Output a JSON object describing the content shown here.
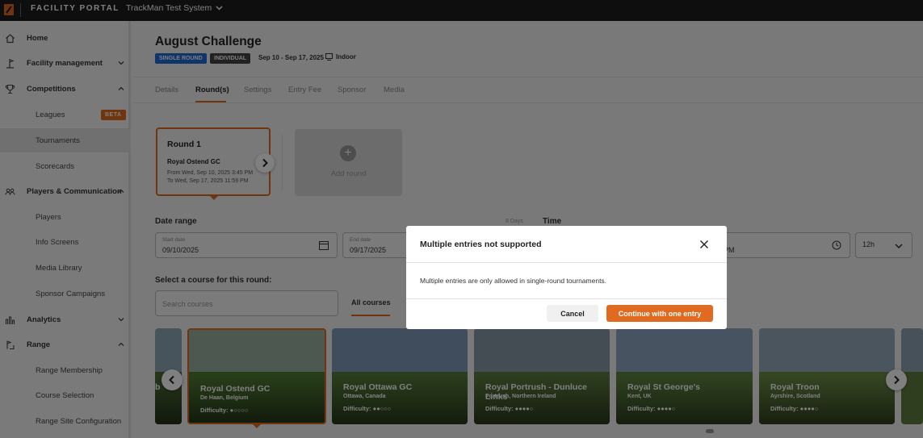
{
  "topbar": {
    "portal_title": "FACILITY PORTAL",
    "facility": "TrackMan Test System"
  },
  "sidebar": {
    "items": [
      {
        "label": "Home",
        "icon": "home-icon"
      },
      {
        "label": "Facility management",
        "icon": "facility-icon"
      },
      {
        "label": "Competitions",
        "icon": "trophy-icon"
      },
      {
        "label": "Leagues",
        "badge": "BETA"
      },
      {
        "label": "Tournaments"
      },
      {
        "label": "Scorecards"
      },
      {
        "label": "Players & Communication",
        "icon": "players-icon"
      },
      {
        "label": "Players"
      },
      {
        "label": "Info Screens"
      },
      {
        "label": "Media Library"
      },
      {
        "label": "Sponsor Campaigns"
      },
      {
        "label": "Analytics",
        "icon": "analytics-icon"
      },
      {
        "label": "Range",
        "icon": "range-icon"
      },
      {
        "label": "Range Membership"
      },
      {
        "label": "Course Selection"
      },
      {
        "label": "Range Site Configuration"
      }
    ]
  },
  "header": {
    "title": "August Challenge",
    "badge_single": "SINGLE ROUND",
    "badge_individual": "INDIVIDUAL",
    "dates": "Sep 10 - Sep 17, 2025",
    "location": "Indoor"
  },
  "tabs": [
    "Details",
    "Round(s)",
    "Settings",
    "Entry Fee",
    "Sponsor",
    "Media"
  ],
  "round": {
    "title": "Round 1",
    "course": "Royal Ostend GC",
    "from": "From Wed, Sep 10, 2025 3:45 PM",
    "to": "To Wed, Sep 17, 2025 11:59 PM",
    "add_label": "Add round"
  },
  "date_range": {
    "label": "Date range",
    "days": "8 Days",
    "start_label": "Start date",
    "start_value": "09/10/2025",
    "end_label": "End date",
    "end_value": "09/17/2025"
  },
  "time": {
    "label": "Time",
    "value_partial": "PM",
    "format": "12h"
  },
  "courses": {
    "label": "Select a course for this round:",
    "search_placeholder": "Search courses",
    "tab": "All courses",
    "partial_text": "b",
    "items": [
      {
        "name": "Royal Ostend GC",
        "location": "De Haan, Belgium",
        "difficulty": "Difficulty: ●○○○○"
      },
      {
        "name": "Royal Ottawa GC",
        "location": "Ottawa, Canada",
        "difficulty": "Difficulty: ●●○○○"
      },
      {
        "name": "Royal Portrush - Dunluce Links",
        "location": "Portrush, Northern Ireland",
        "difficulty": "Difficulty: ●●●●○"
      },
      {
        "name": "Royal St George's",
        "location": "Kent, UK",
        "difficulty": "Difficulty: ●●●●○"
      },
      {
        "name": "Royal Troon",
        "location": "Ayrshire, Scotland",
        "difficulty": "Difficulty: ●●●●○"
      }
    ]
  },
  "modal": {
    "title": "Multiple entries not supported",
    "body": "Multiple entries are only allowed in single-round tournaments.",
    "cancel": "Cancel",
    "confirm": "Continue with one entry"
  },
  "colors": {
    "accent": "#e06a1f",
    "topbar": "#1c1c1c",
    "badge_blue": "#1f6bd6"
  }
}
